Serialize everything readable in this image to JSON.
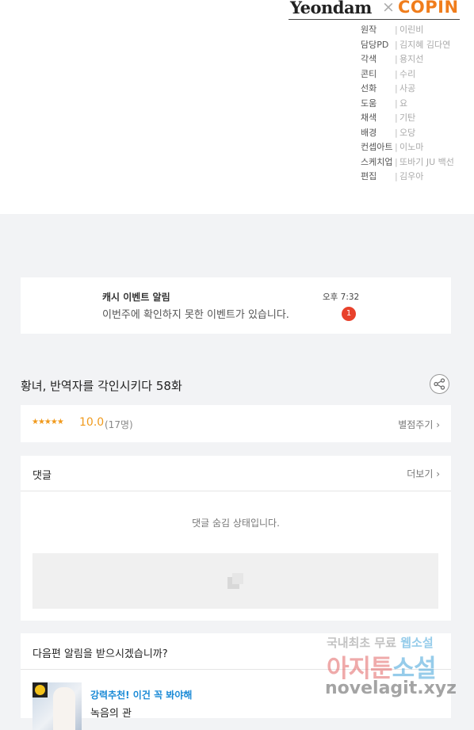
{
  "brand": {
    "publisher": "Yeondam",
    "cross": "×",
    "partner": "COPIN"
  },
  "credits": [
    {
      "role": "원작",
      "name": "이린비"
    },
    {
      "role": "담당PD",
      "name": "김지혜  김다연"
    },
    {
      "role": "각색",
      "name": "용지선"
    },
    {
      "role": "콘티",
      "name": "수리"
    },
    {
      "role": "선화",
      "name": "사공"
    },
    {
      "role": "도움",
      "name": "요"
    },
    {
      "role": "채색",
      "name": "기탄"
    },
    {
      "role": "배경",
      "name": "오당"
    },
    {
      "role": "컨셉아트",
      "name": "이노마"
    },
    {
      "role": "스케치업",
      "name": "또바기  JU  백선"
    },
    {
      "role": "편집",
      "name": "김우아"
    }
  ],
  "notification": {
    "title": "캐시 이벤트 알림",
    "message": "이번주에 확인하지 못한 이벤트가 있습니다.",
    "time": "오후 7:32",
    "badge": "1"
  },
  "episode": {
    "title": "황녀, 반역자를 각인시키다 58화"
  },
  "rating": {
    "stars": "★★★★★",
    "score": "10.0",
    "count": "(17명)",
    "rate_link": "별점주기 ›"
  },
  "comments": {
    "title": "댓글",
    "more": "더보기 ›",
    "hidden_message": "댓글 숨김 상태입니다."
  },
  "next": {
    "question": "다음편 알림을 받으시겠습니까?",
    "recommend": "강력추천! 이건 꼭 봐야해",
    "work_title": "녹음의 관"
  },
  "watermark": {
    "line1_a": "국내최초 무료 ",
    "line1_b": "웹소설",
    "line2_a": "아지툰",
    "line2_b": "소설",
    "line3": "novelagit.xyz"
  },
  "colors": {
    "accent_orange": "#f09a1d",
    "badge_red": "#e8412b",
    "link_blue": "#1a8ad6",
    "copin_orange": "#f07d1c"
  }
}
